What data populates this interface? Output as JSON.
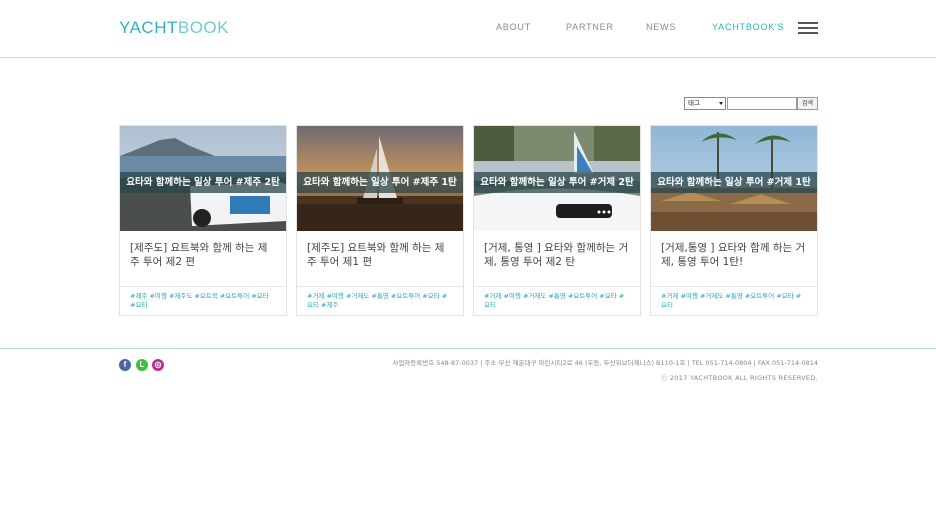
{
  "header": {
    "logo_part1": "YACHT",
    "logo_part2": "BOOK",
    "nav": [
      {
        "label": "ABOUT"
      },
      {
        "label": "PARTNER"
      },
      {
        "label": "NEWS"
      },
      {
        "label": "YACHTBOOK'S"
      }
    ],
    "accent_color": "#2bb3c0"
  },
  "search": {
    "select_value": "태그",
    "input_value": "",
    "button_label": "검색"
  },
  "cards": [
    {
      "banner": "요타와 함께하는 일상 투어 #제주 2탄",
      "title": "[제주도] 요트북와 함께 하는 제주 투어 제2 편",
      "tags": "#제주 #여행 #제주도 #요트북 #요트투어 #요타 #요티"
    },
    {
      "banner": "요타와 함께하는 일상 투어 #제주 1탄",
      "title": "[제주도] 요트북와 함께 하는 제주 투어 제1 편",
      "tags": "#거제 #여행 #거제도 #통영 #요트투어 #요타 #요티 #제주"
    },
    {
      "banner": "요타와 함께하는 일상 투어 #거제 2탄",
      "title": "[거제, 통영 ] 요타와 함께하는 거제, 통영 투어 제2 탄",
      "tags": "#거제 #여행 #거제도 #통영 #요트투어 #요타 #요티"
    },
    {
      "banner": "요타와 함께하는 일상 투어 #거제 1탄",
      "title": "[거제,통영 ] 요타와 함께 하는 거제, 통영 투어 1탄!",
      "tags": "#거제 #여행 #거제도 #통영 #요트투어 #요타 #요티"
    }
  ],
  "footer": {
    "info": "사업자등록번호 548-87-0037  |  주소 부산 해운대구 마린시티2로 46 (우동, 두산위브더제니스) B110-1호  |  TEL 051-714-0804  |  FAX 051-714-0814",
    "copyright": "ⓒ 2017 YACHTBOOK ALL RIGHTS RESERVED.",
    "social": [
      {
        "icon": "facebook-icon",
        "glyph": "f"
      },
      {
        "icon": "line-icon",
        "glyph": "L"
      },
      {
        "icon": "instagram-icon",
        "glyph": "◎"
      }
    ]
  }
}
